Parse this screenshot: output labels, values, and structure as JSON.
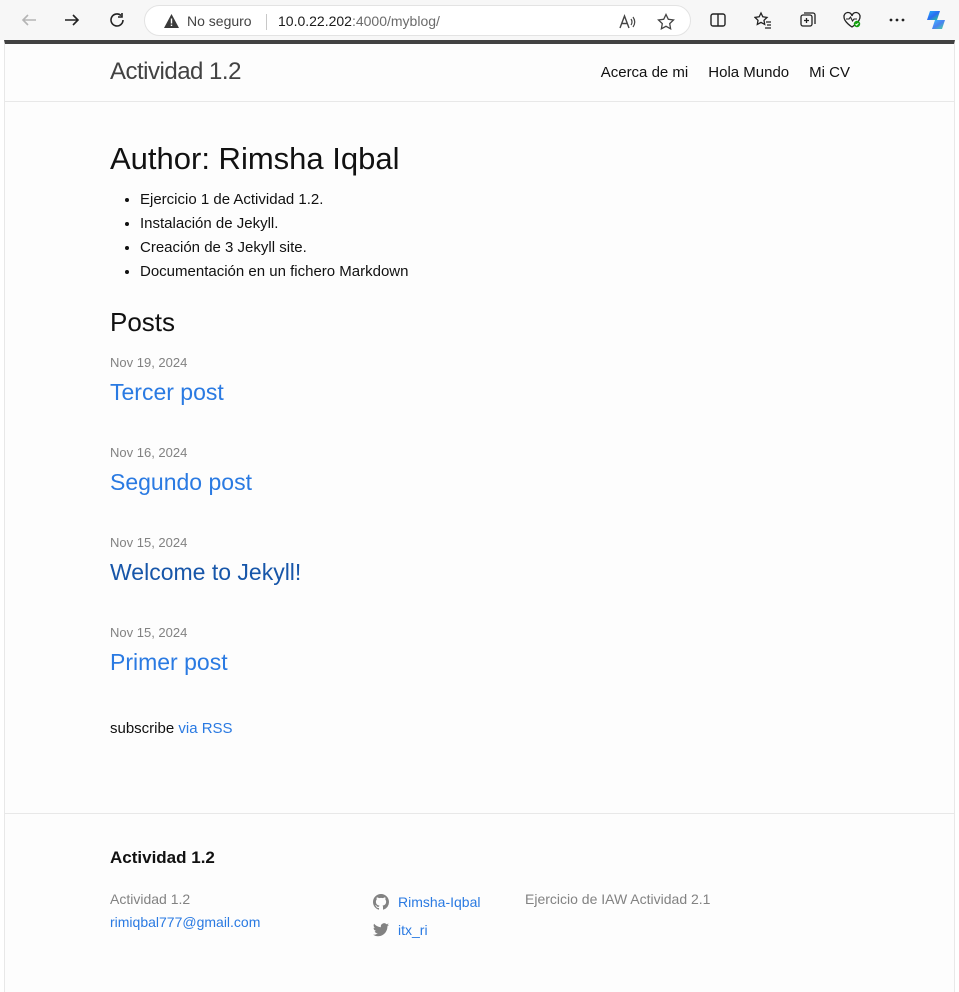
{
  "browser": {
    "security_label": "No seguro",
    "url_host": "10.0.22.202",
    "url_rest": ":4000/myblog/"
  },
  "header": {
    "site_title": "Actividad 1.2",
    "nav": [
      "Acerca de mi",
      "Hola Mundo",
      "Mi CV"
    ]
  },
  "main": {
    "author_heading": "Author: Rimsha Iqbal",
    "bullets": [
      "Ejercicio 1 de Actividad 1.2.",
      "Instalación de Jekyll.",
      "Creación de 3 Jekyll site.",
      "Documentación en un fichero Markdown"
    ],
    "posts_heading": "Posts",
    "posts": [
      {
        "date": "Nov 19, 2024",
        "title": "Tercer post"
      },
      {
        "date": "Nov 16, 2024",
        "title": "Segundo post"
      },
      {
        "date": "Nov 15, 2024",
        "title": "Welcome to Jekyll!"
      },
      {
        "date": "Nov 15, 2024",
        "title": "Primer post"
      }
    ],
    "subscribe_text": "subscribe",
    "rss_link": "via RSS"
  },
  "footer": {
    "title": "Actividad 1.2",
    "col1_name": "Actividad 1.2",
    "email": "rimiqbal777@gmail.com",
    "github_user": "Rimsha-Iqbal",
    "twitter_user": "itx_ri",
    "description": "Ejercicio de IAW Actividad 2.1"
  },
  "colors": {
    "link": "#2a7ae2",
    "link_visited": "#1756a9",
    "muted": "#828282",
    "header_border_top": "#424242"
  }
}
